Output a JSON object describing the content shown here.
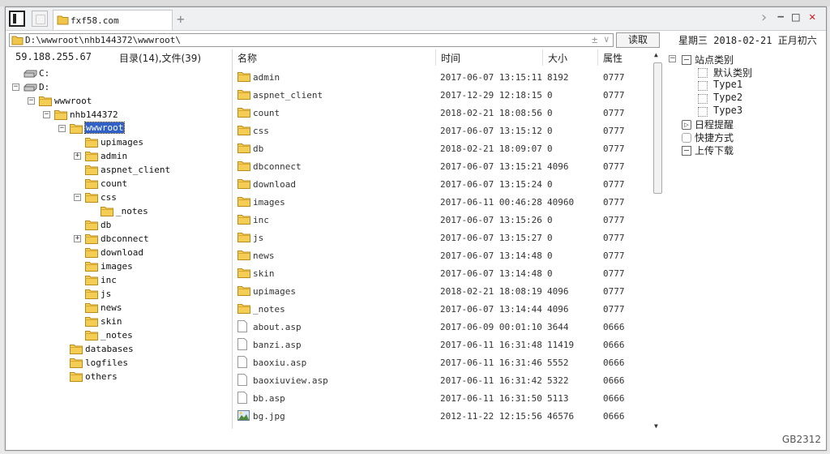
{
  "window": {
    "tab_title": "fxf58.com",
    "new_tab_label": "+",
    "controls": {
      "forward": "›",
      "minimize": "−",
      "maximize": "□",
      "close": "✕"
    }
  },
  "address": {
    "path": "D:\\wwwroot\\nhb144372\\wwwroot\\",
    "read_button": "读取",
    "plus_label": "±",
    "dropdown_label": "∨"
  },
  "date_bar": "星期三  2018-02-21  正月初六",
  "left_header": {
    "ip": "59.188.255.67",
    "summary": "目录(14),文件(39)"
  },
  "tree": [
    {
      "label": "C:",
      "depth": 0,
      "type": "drive",
      "toggle": ""
    },
    {
      "label": "D:",
      "depth": 0,
      "type": "drive",
      "toggle": "−"
    },
    {
      "label": "wwwroot",
      "depth": 1,
      "type": "folder",
      "toggle": "−"
    },
    {
      "label": "nhb144372",
      "depth": 2,
      "type": "folder",
      "toggle": "−"
    },
    {
      "label": "wwwroot",
      "depth": 3,
      "type": "folder",
      "toggle": "−",
      "selected": true
    },
    {
      "label": "upimages",
      "depth": 4,
      "type": "folder",
      "toggle": ""
    },
    {
      "label": "admin",
      "depth": 4,
      "type": "folder",
      "toggle": "+"
    },
    {
      "label": "aspnet_client",
      "depth": 4,
      "type": "folder",
      "toggle": ""
    },
    {
      "label": "count",
      "depth": 4,
      "type": "folder",
      "toggle": ""
    },
    {
      "label": "css",
      "depth": 4,
      "type": "folder",
      "toggle": "−"
    },
    {
      "label": "_notes",
      "depth": 5,
      "type": "folder",
      "toggle": ""
    },
    {
      "label": "db",
      "depth": 4,
      "type": "folder",
      "toggle": ""
    },
    {
      "label": "dbconnect",
      "depth": 4,
      "type": "folder",
      "toggle": "+"
    },
    {
      "label": "download",
      "depth": 4,
      "type": "folder",
      "toggle": ""
    },
    {
      "label": "images",
      "depth": 4,
      "type": "folder",
      "toggle": ""
    },
    {
      "label": "inc",
      "depth": 4,
      "type": "folder",
      "toggle": ""
    },
    {
      "label": "js",
      "depth": 4,
      "type": "folder",
      "toggle": ""
    },
    {
      "label": "news",
      "depth": 4,
      "type": "folder",
      "toggle": ""
    },
    {
      "label": "skin",
      "depth": 4,
      "type": "folder",
      "toggle": ""
    },
    {
      "label": "_notes",
      "depth": 4,
      "type": "folder",
      "toggle": ""
    },
    {
      "label": "databases",
      "depth": 3,
      "type": "folder",
      "toggle": ""
    },
    {
      "label": "logfiles",
      "depth": 3,
      "type": "folder",
      "toggle": ""
    },
    {
      "label": "others",
      "depth": 3,
      "type": "folder",
      "toggle": ""
    }
  ],
  "columns": {
    "name": "名称",
    "time": "时间",
    "size": "大小",
    "attr": "属性"
  },
  "files": [
    {
      "name": "admin",
      "time": "2017-06-07 13:15:11",
      "size": "8192",
      "attr": "0777",
      "type": "folder"
    },
    {
      "name": "aspnet_client",
      "time": "2017-12-29 12:18:15",
      "size": "0",
      "attr": "0777",
      "type": "folder"
    },
    {
      "name": "count",
      "time": "2018-02-21 18:08:56",
      "size": "0",
      "attr": "0777",
      "type": "folder"
    },
    {
      "name": "css",
      "time": "2017-06-07 13:15:12",
      "size": "0",
      "attr": "0777",
      "type": "folder"
    },
    {
      "name": "db",
      "time": "2018-02-21 18:09:07",
      "size": "0",
      "attr": "0777",
      "type": "folder"
    },
    {
      "name": "dbconnect",
      "time": "2017-06-07 13:15:21",
      "size": "4096",
      "attr": "0777",
      "type": "folder"
    },
    {
      "name": "download",
      "time": "2017-06-07 13:15:24",
      "size": "0",
      "attr": "0777",
      "type": "folder"
    },
    {
      "name": "images",
      "time": "2017-06-11 00:46:28",
      "size": "40960",
      "attr": "0777",
      "type": "folder"
    },
    {
      "name": "inc",
      "time": "2017-06-07 13:15:26",
      "size": "0",
      "attr": "0777",
      "type": "folder"
    },
    {
      "name": "js",
      "time": "2017-06-07 13:15:27",
      "size": "0",
      "attr": "0777",
      "type": "folder"
    },
    {
      "name": "news",
      "time": "2017-06-07 13:14:48",
      "size": "0",
      "attr": "0777",
      "type": "folder"
    },
    {
      "name": "skin",
      "time": "2017-06-07 13:14:48",
      "size": "0",
      "attr": "0777",
      "type": "folder"
    },
    {
      "name": "upimages",
      "time": "2018-02-21 18:08:19",
      "size": "4096",
      "attr": "0777",
      "type": "folder"
    },
    {
      "name": "_notes",
      "time": "2017-06-07 13:14:44",
      "size": "4096",
      "attr": "0777",
      "type": "folder"
    },
    {
      "name": "about.asp",
      "time": "2017-06-09 00:01:10",
      "size": "3644",
      "attr": "0666",
      "type": "file"
    },
    {
      "name": "banzi.asp",
      "time": "2017-06-11 16:31:48",
      "size": "11419",
      "attr": "0666",
      "type": "file"
    },
    {
      "name": "baoxiu.asp",
      "time": "2017-06-11 16:31:46",
      "size": "5552",
      "attr": "0666",
      "type": "file"
    },
    {
      "name": "baoxiuview.asp",
      "time": "2017-06-11 16:31:42",
      "size": "5322",
      "attr": "0666",
      "type": "file"
    },
    {
      "name": "bb.asp",
      "time": "2017-06-11 16:31:50",
      "size": "5113",
      "attr": "0666",
      "type": "file"
    },
    {
      "name": "bg.jpg",
      "time": "2012-11-22 12:15:56",
      "size": "46576",
      "attr": "0666",
      "type": "image"
    }
  ],
  "right_panel": [
    {
      "label": "站点类别",
      "depth": 0,
      "toggle": "−",
      "icon": "square"
    },
    {
      "label": "默认类别",
      "depth": 1,
      "toggle": "",
      "icon": "dotted"
    },
    {
      "label": "Type1",
      "depth": 1,
      "toggle": "",
      "icon": "dotted"
    },
    {
      "label": "Type2",
      "depth": 1,
      "toggle": "",
      "icon": "dotted"
    },
    {
      "label": "Type3",
      "depth": 1,
      "toggle": "",
      "icon": "dotted"
    },
    {
      "label": "日程提醒",
      "depth": 0,
      "toggle": "",
      "icon": "clock"
    },
    {
      "label": "快捷方式",
      "depth": 0,
      "toggle": "",
      "icon": "hand"
    },
    {
      "label": "上传下载",
      "depth": 0,
      "toggle": "",
      "icon": "square"
    }
  ],
  "status_text": "GB2312",
  "colors": {
    "folder": "#f0c64a",
    "folder_dark": "#c89a24",
    "selection": "#3161c7",
    "border": "#9a9a9a"
  }
}
